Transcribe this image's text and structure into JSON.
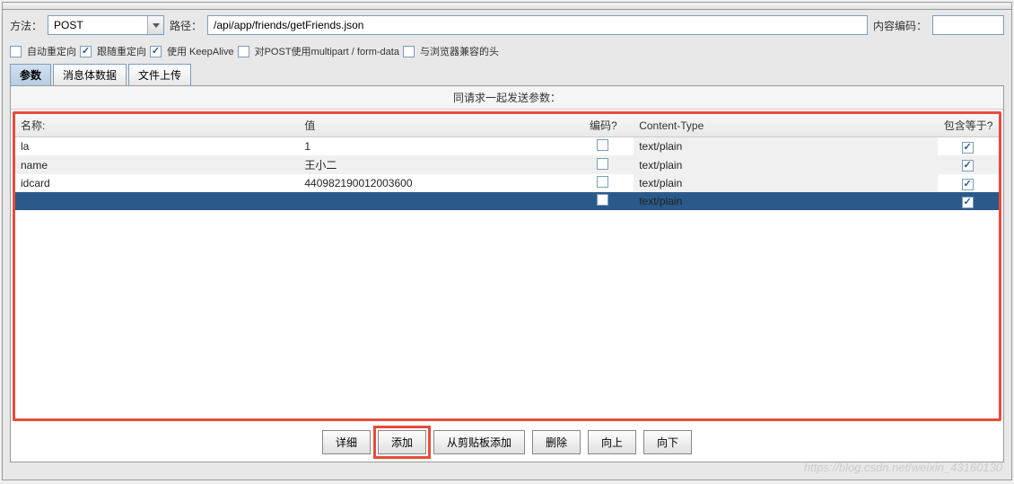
{
  "header": {
    "method_label": "方法：",
    "method_value": "POST",
    "path_label": "路径：",
    "path_value": "/api/app/friends/getFriends.json",
    "encoding_label": "内容编码：",
    "encoding_value": ""
  },
  "options": {
    "auto_redirect": {
      "label": "自动重定向",
      "checked": false
    },
    "follow_redirect": {
      "label": "跟随重定向",
      "checked": true
    },
    "keepalive": {
      "label": "使用 KeepAlive",
      "checked": true
    },
    "multipart": {
      "label": "对POST使用multipart / form-data",
      "checked": false
    },
    "browser_headers": {
      "label": "与浏览器兼容的头",
      "checked": false
    }
  },
  "tabs": {
    "params": "参数",
    "body": "消息体数据",
    "upload": "文件上传",
    "active": "params"
  },
  "inner": {
    "title": "同请求一起发送参数：",
    "columns": {
      "name": "名称:",
      "value": "值",
      "encode": "编码?",
      "content_type": "Content-Type",
      "include": "包含等于?"
    },
    "rows": [
      {
        "name": "la",
        "value": "1",
        "encode": false,
        "content_type": "text/plain",
        "include": true,
        "selected": false
      },
      {
        "name": "name",
        "value": "王小二",
        "encode": false,
        "content_type": "text/plain",
        "include": true,
        "selected": false
      },
      {
        "name": "idcard",
        "value": "440982190012003600",
        "encode": false,
        "content_type": "text/plain",
        "include": true,
        "selected": false
      },
      {
        "name": "",
        "value": "",
        "encode": false,
        "content_type": "text/plain",
        "include": true,
        "selected": true
      }
    ]
  },
  "buttons": {
    "detail": "详细",
    "add": "添加",
    "clipboard": "从剪贴板添加",
    "delete": "删除",
    "up": "向上",
    "down": "向下"
  },
  "watermark": "https://blog.csdn.net/weixin_43160130"
}
